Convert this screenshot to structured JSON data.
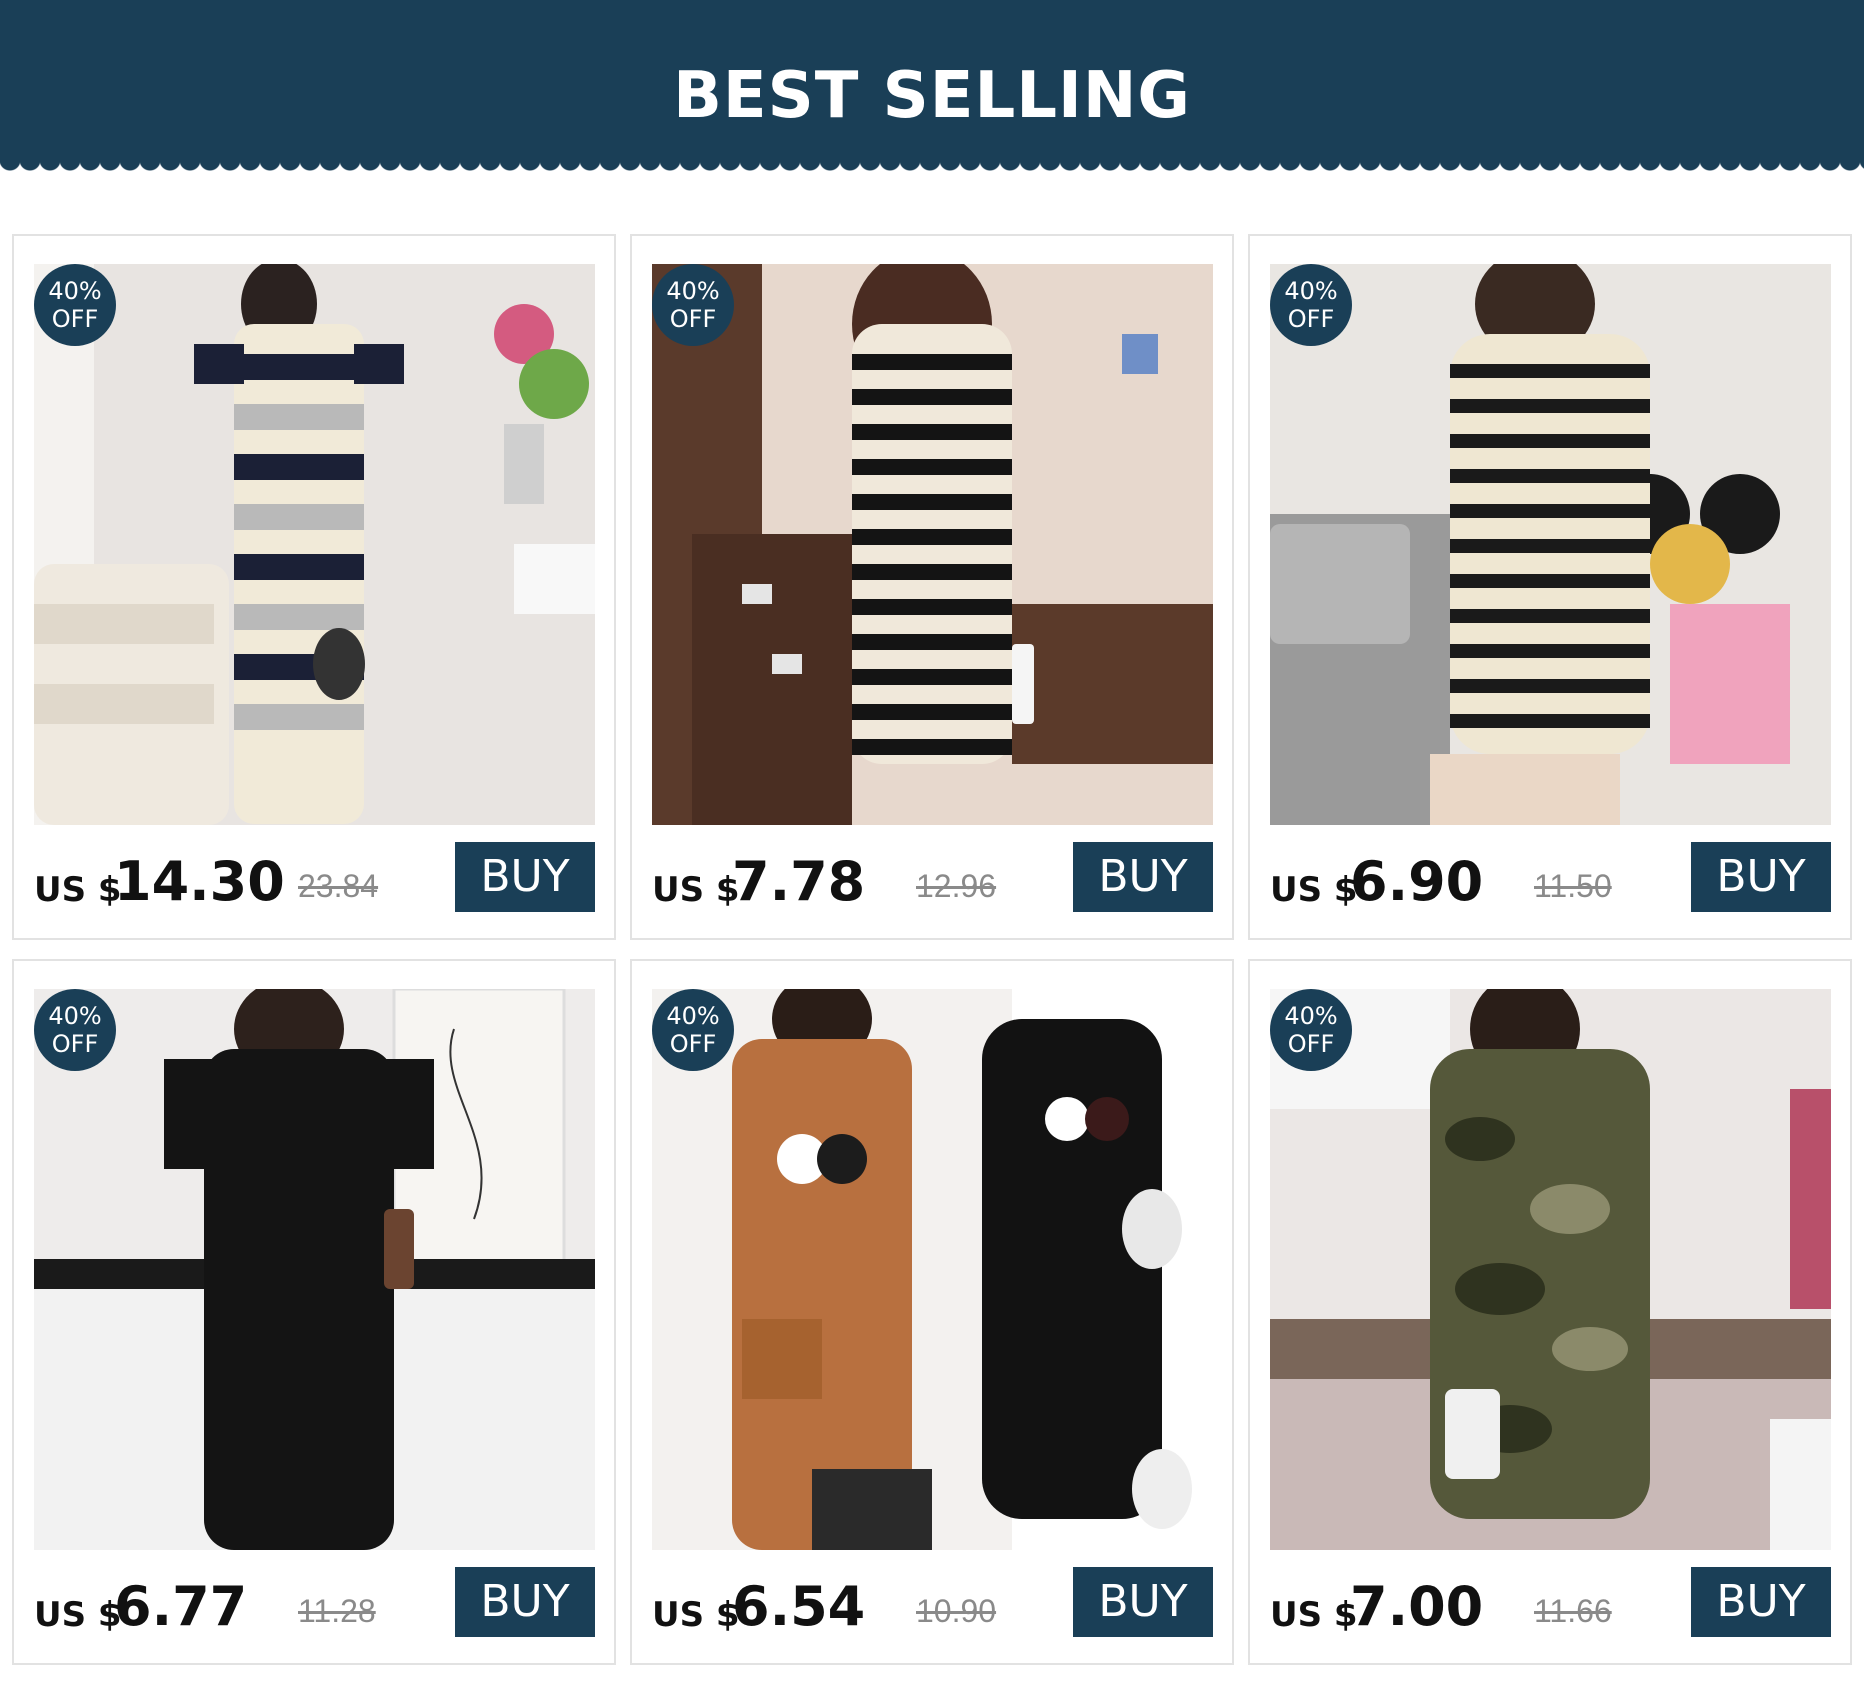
{
  "banner": {
    "title": "BEST SELLING"
  },
  "colors": {
    "brand": "#1a3f57",
    "price": "#111111",
    "old_price": "#8a8a8a"
  },
  "products": [
    {
      "badge_pct": "40%",
      "badge_off": "OFF",
      "currency": "US $",
      "price": "14.30",
      "old_price": "23.84",
      "buy_label": "BUY",
      "image": "striped-dress-navy-grey-photo"
    },
    {
      "badge_pct": "40%",
      "badge_off": "OFF",
      "currency": "US $",
      "price": "7.78",
      "old_price": "12.96",
      "buy_label": "BUY",
      "image": "striped-vneck-dress-photo"
    },
    {
      "badge_pct": "40%",
      "badge_off": "OFF",
      "currency": "US $",
      "price": "6.90",
      "old_price": "11.50",
      "buy_label": "BUY",
      "image": "striped-drawstring-dress-photo"
    },
    {
      "badge_pct": "40%",
      "badge_off": "OFF",
      "currency": "US $",
      "price": "6.77",
      "old_price": "11.28",
      "buy_label": "BUY",
      "image": "black-tshirt-dress-photo"
    },
    {
      "badge_pct": "40%",
      "badge_off": "OFF",
      "currency": "US $",
      "price": "6.54",
      "old_price": "10.90",
      "buy_label": "BUY",
      "image": "cat-print-sleeveless-dress-photo"
    },
    {
      "badge_pct": "40%",
      "badge_off": "OFF",
      "currency": "US $",
      "price": "7.00",
      "old_price": "11.66",
      "buy_label": "BUY",
      "image": "camo-offshoulder-dress-photo"
    }
  ]
}
